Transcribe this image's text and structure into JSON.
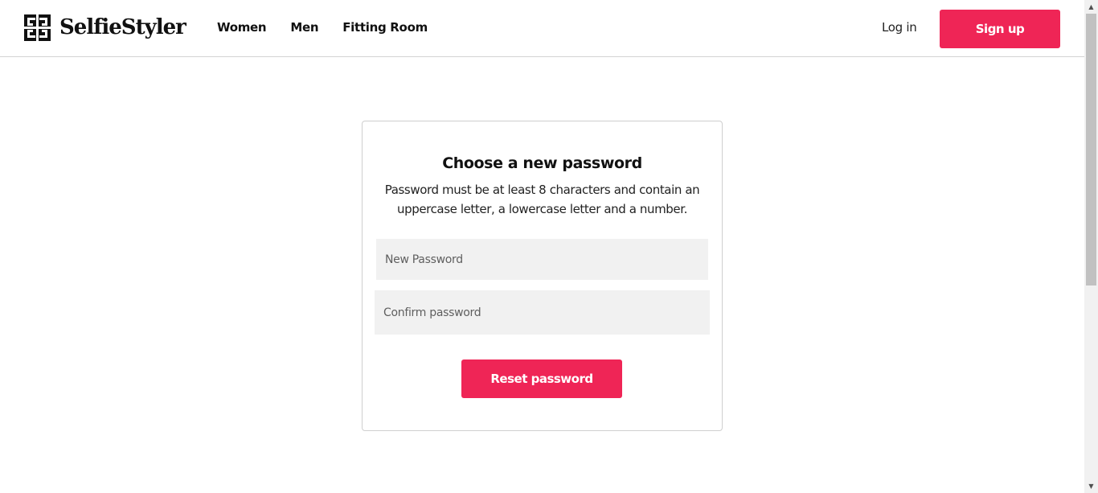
{
  "brand": {
    "name": "SelfieStyler",
    "logo_icon": "selfiestyler-logo-icon"
  },
  "nav": {
    "items": [
      {
        "label": "Women"
      },
      {
        "label": "Men"
      },
      {
        "label": "Fitting Room"
      }
    ]
  },
  "auth": {
    "login_label": "Log in",
    "signup_label": "Sign up"
  },
  "reset_form": {
    "title": "Choose a new password",
    "description": "Password must be at least 8 characters and contain an uppercase letter, a lowercase letter and a number.",
    "new_password_placeholder": "New Password",
    "confirm_password_placeholder": "Confirm password",
    "submit_label": "Reset password"
  },
  "colors": {
    "accent": "#ef2556",
    "input_background": "#f1f1f1",
    "border": "#cfcfcf"
  },
  "icons": {
    "scroll_up": "arrow-up-icon",
    "scroll_down": "arrow-down-icon"
  }
}
